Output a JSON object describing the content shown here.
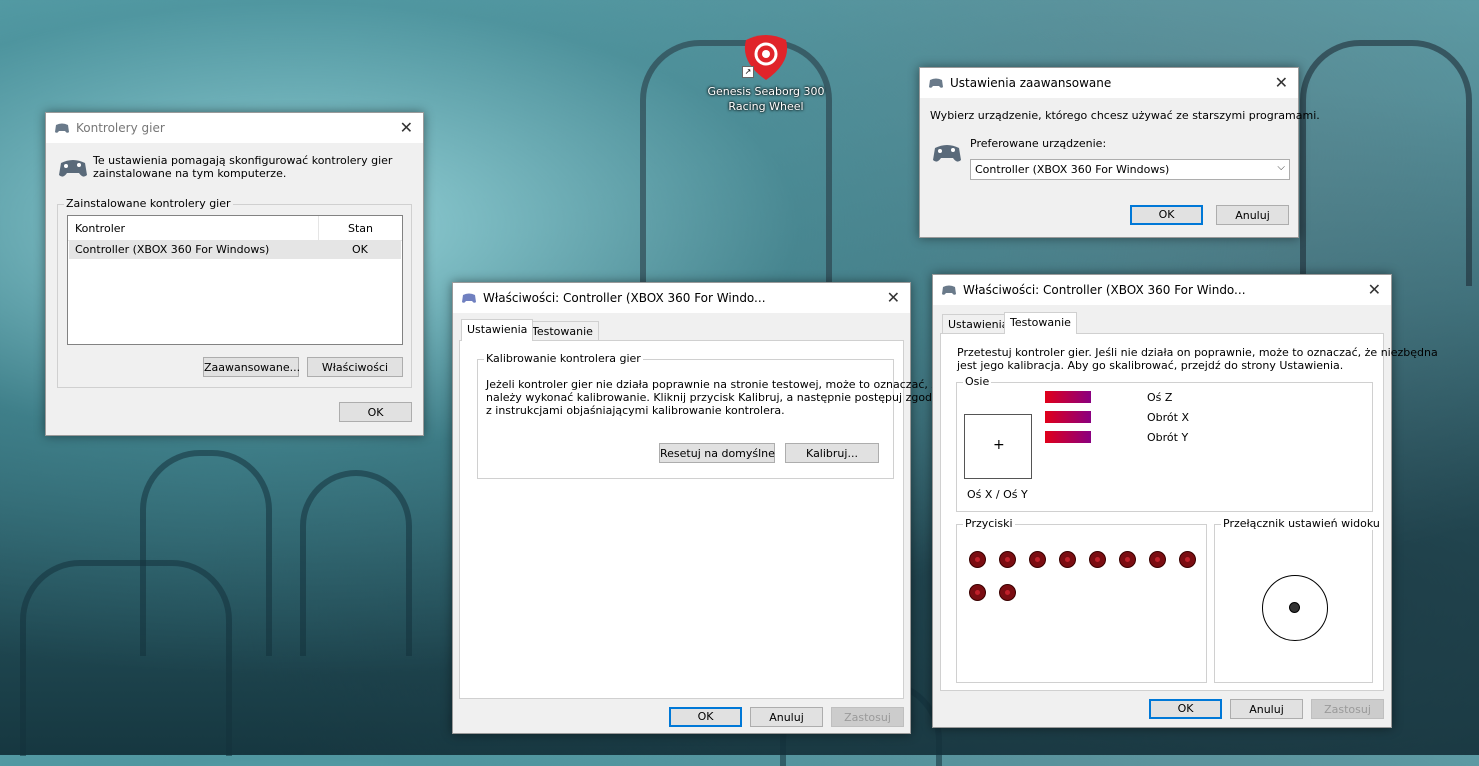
{
  "desktop": {
    "shortcut_label": "Genesis Seaborg 300 Racing Wheel",
    "shortcut_label_line1": "Genesis Seaborg 300",
    "shortcut_label_line2": "Racing Wheel",
    "brand_color": "#e0242a"
  },
  "game_controllers": {
    "title": "Kontrolery gier",
    "intro_line1": "Te ustawienia pomagają skonfigurować kontrolery gier",
    "intro_line2": "zainstalowane na tym komputerze.",
    "group_label": "Zainstalowane kontrolery gier",
    "columns": [
      "Kontroler",
      "Stan"
    ],
    "rows": [
      {
        "name": "Controller (XBOX 360 For Windows)",
        "status": "OK"
      }
    ],
    "advanced_button": "Zaawansowane...",
    "properties_button": "Właściwości",
    "ok_button": "OK"
  },
  "advanced": {
    "title": "Ustawienia zaawansowane",
    "description": "Wybierz urządzenie, którego chcesz używać ze starszymi programami.",
    "preferred_label": "Preferowane urządzenie:",
    "preferred_value": "Controller (XBOX 360 For Windows)",
    "ok_button": "OK",
    "cancel_button": "Anuluj"
  },
  "props_settings": {
    "title": "Właściwości: Controller (XBOX 360 For Windo...",
    "tabs": [
      "Ustawienia",
      "Testowanie"
    ],
    "active_tab": "Ustawienia",
    "calibration_group": "Kalibrowanie kontrolera gier",
    "calibration_line1": "Jeżeli kontroler gier nie działa poprawnie na stronie testowej, może to oznaczać, że",
    "calibration_line2": "należy wykonać kalibrowanie. Kliknij przycisk Kalibruj, a następnie postępuj zgodnie",
    "calibration_line3": "z instrukcjami objaśniającymi kalibrowanie kontrolera.",
    "reset_button": "Resetuj na domyślne",
    "calibrate_button": "Kalibruj...",
    "ok_button": "OK",
    "cancel_button": "Anuluj",
    "apply_button": "Zastosuj"
  },
  "props_test": {
    "title": "Właściwości: Controller (XBOX 360 For Windo...",
    "tabs": [
      "Ustawienia",
      "Testowanie"
    ],
    "active_tab": "Testowanie",
    "intro_line1": "Przetestuj kontroler gier. Jeśli nie działa on poprawnie, może to oznaczać, że niezbędna",
    "intro_line2": "jest jego kalibracja. Aby go skalibrować, przejdź do strony Ustawienia.",
    "axes_group": "Osie",
    "xy_label": "Oś X / Oś Y",
    "crosshair": "+",
    "axis_bars": [
      {
        "label": "Oś Z",
        "level": 1.0
      },
      {
        "label": "Obrót X",
        "level": 1.0
      },
      {
        "label": "Obrót Y",
        "level": 1.0
      }
    ],
    "buttons_group": "Przyciski",
    "button_count": 10,
    "pov_group": "Przełącznik ustawień widoku",
    "ok_button": "OK",
    "cancel_button": "Anuluj",
    "apply_button": "Zastosuj",
    "bar_color_start": "#e0001a",
    "bar_color_end": "#8a0080"
  }
}
